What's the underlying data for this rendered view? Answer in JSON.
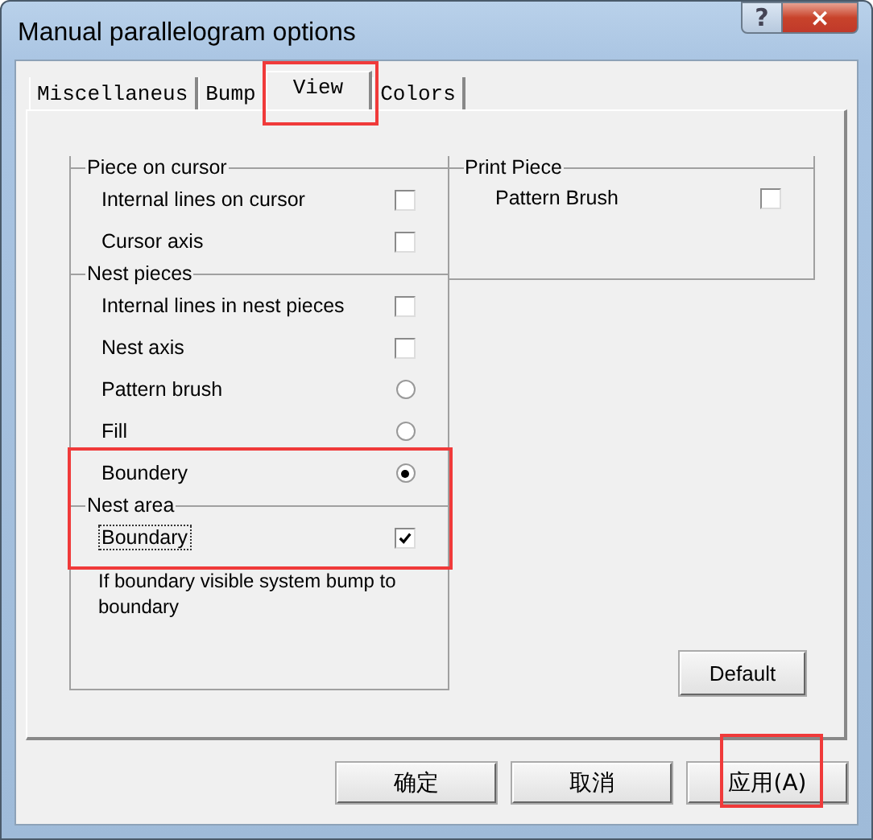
{
  "window": {
    "title": "Manual parallelogram options",
    "help_button": "?",
    "close_button": "×"
  },
  "tabs": [
    {
      "label": "Miscellaneus",
      "selected": false,
      "annotated": false
    },
    {
      "label": "Bump",
      "selected": false,
      "annotated": false
    },
    {
      "label": "View",
      "selected": true,
      "annotated": true
    },
    {
      "label": "Colors",
      "selected": false,
      "annotated": false
    }
  ],
  "piece_on_cursor": {
    "title": "Piece on cursor",
    "rows": [
      {
        "kind": "checkbox",
        "label": "Internal lines on cursor",
        "checked": false,
        "focused": false
      },
      {
        "kind": "checkbox",
        "label": "Cursor axis",
        "checked": false,
        "focused": false
      }
    ]
  },
  "nest_pieces": {
    "title": "Nest pieces",
    "rows": [
      {
        "kind": "checkbox",
        "label": "Internal lines in nest pieces",
        "checked": false,
        "focused": false
      },
      {
        "kind": "checkbox",
        "label": "Nest axis",
        "checked": false,
        "focused": false
      },
      {
        "kind": "radio",
        "label": "Pattern brush",
        "selected": false,
        "focused": false
      },
      {
        "kind": "radio",
        "label": "Fill",
        "selected": false,
        "focused": false
      },
      {
        "kind": "radio",
        "label": "Boundery",
        "selected": true,
        "focused": false
      }
    ]
  },
  "nest_area": {
    "title": "Nest area",
    "annotated": true,
    "rows": [
      {
        "kind": "checkbox",
        "label": "Boundary",
        "checked": true,
        "focused": true
      }
    ],
    "note": "If boundary visible system bump to boundary"
  },
  "print_piece": {
    "title": "Print Piece",
    "rows": [
      {
        "kind": "checkbox",
        "label": "Pattern Brush",
        "checked": false,
        "focused": false
      }
    ]
  },
  "default_button": "Default",
  "buttons": [
    {
      "label": "确定",
      "annotated": false
    },
    {
      "label": "取消",
      "annotated": false
    },
    {
      "label": "应用(A)",
      "annotated": true
    }
  ]
}
